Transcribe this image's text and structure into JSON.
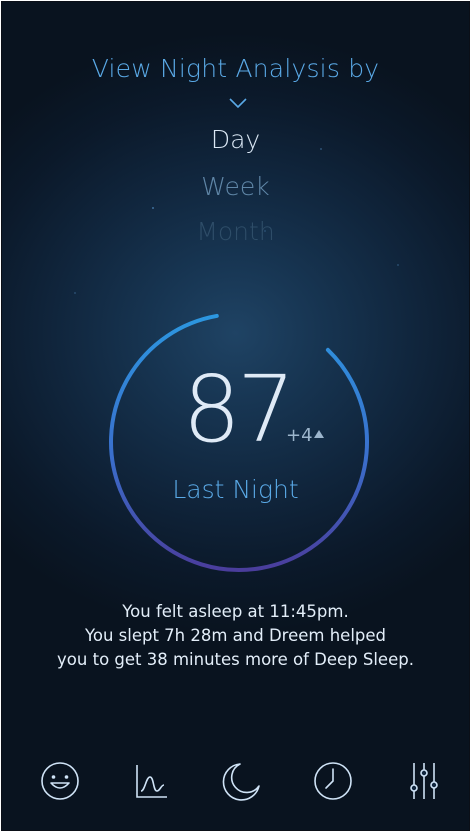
{
  "header": {
    "title": "View Night Analysis by"
  },
  "period_selector": {
    "options": [
      "Day",
      "Week",
      "Month"
    ],
    "selected": "Day"
  },
  "score": {
    "value": "87",
    "delta": "+4",
    "label": "Last Night",
    "ring_fill_fraction": 0.85
  },
  "summary": {
    "lines": [
      "You felt asleep at 11:45pm.",
      "You slept 7h 28m and Dreem helped",
      "you to get 38 minutes more of Deep Sleep."
    ]
  },
  "bottom_nav": {
    "items": [
      {
        "icon": "smiley-icon"
      },
      {
        "icon": "line-chart-icon"
      },
      {
        "icon": "moon-icon"
      },
      {
        "icon": "clock-icon"
      },
      {
        "icon": "sliders-icon"
      }
    ]
  },
  "colors": {
    "accent": "#5aa9e6",
    "ring_start": "#2c97e0",
    "ring_end": "#4a3d9c",
    "background": "#10253c"
  }
}
